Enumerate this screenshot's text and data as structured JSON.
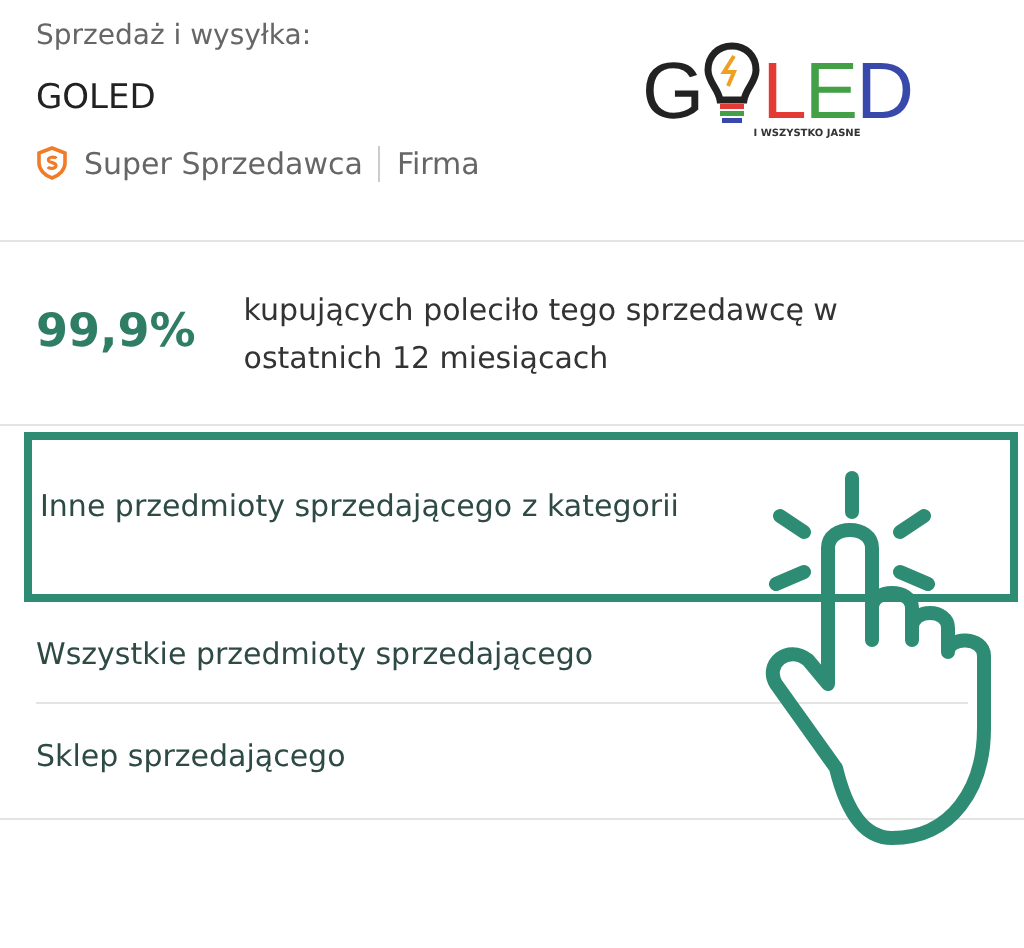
{
  "seller": {
    "label": "Sprzedaż i wysyłka:",
    "name": "GOLED",
    "badge": "Super Sprzedawca",
    "type": "Firma"
  },
  "logo": {
    "first": "G",
    "letters": [
      {
        "text": "L",
        "color": "#e53935"
      },
      {
        "text": "E",
        "color": "#43a047"
      },
      {
        "text": "D",
        "color": "#3949ab"
      }
    ],
    "tagline": "I WSZYSTKO JASNE"
  },
  "recommendation": {
    "percent": "99,9%",
    "text": "kupujących poleciło tego sprzedawcę w ostatnich 12 miesiącach"
  },
  "links": [
    {
      "label": "Inne przedmioty sprzedającego z kategorii",
      "selected": true
    },
    {
      "label": "Wszystkie przedmioty sprzedającego",
      "selected": false
    },
    {
      "label": "Sklep sprzedającego",
      "selected": false
    }
  ]
}
